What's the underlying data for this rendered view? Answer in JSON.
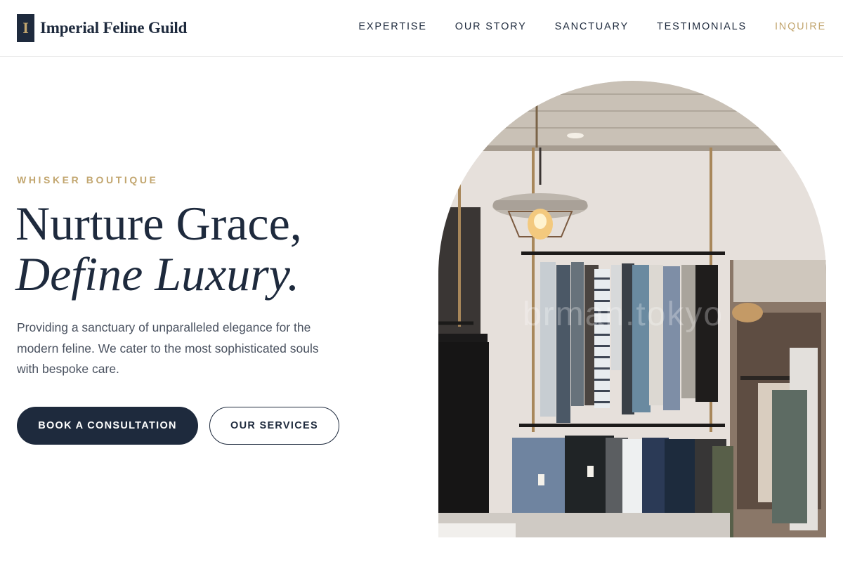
{
  "brand": {
    "mark": "I",
    "name": "Imperial Feline Guild"
  },
  "nav": {
    "items": [
      "EXPERTISE",
      "OUR STORY",
      "SANCTUARY",
      "TESTIMONIALS"
    ],
    "cta": "INQUIRE"
  },
  "hero": {
    "eyebrow": "WHISKER BOUTIQUE",
    "headline_line1": "Nurture Grace,",
    "headline_line2": "Define Luxury.",
    "description": "Providing a sanctuary of unparalleled elegance for the modern feline. We cater to the most sophisticated souls with bespoke care.",
    "primary_button": "BOOK A CONSULTATION",
    "secondary_button": "OUR SERVICES"
  },
  "image": {
    "watermark": "brman.tokyo"
  },
  "colors": {
    "navy": "#1e2a3d",
    "gold": "#c2a66f",
    "text_muted": "#4a5260"
  }
}
